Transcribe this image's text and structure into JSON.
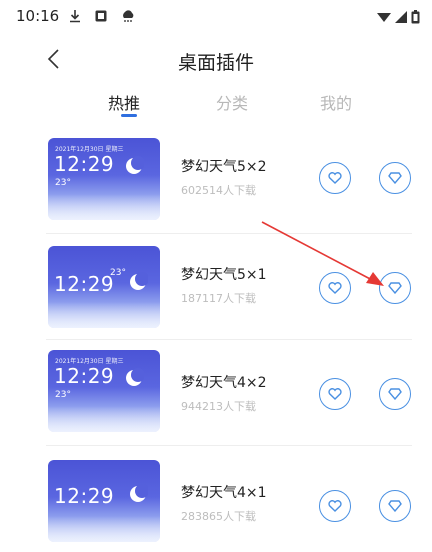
{
  "status_bar": {
    "time": "10:16",
    "icons": [
      "download-icon",
      "image-icon",
      "weather-icon",
      "wifi-icon",
      "signal-icon",
      "battery-icon"
    ]
  },
  "header": {
    "title": "桌面插件",
    "back_icon": "chevron-left-icon"
  },
  "tabs": [
    {
      "label": "热推",
      "active": true
    },
    {
      "label": "分类",
      "active": false
    },
    {
      "label": "我的",
      "active": false
    }
  ],
  "accent_color": "#2f6fe0",
  "button_color": "#4a90e2",
  "annotation_arrow_color": "#e53935",
  "widgets": [
    {
      "name": "梦幻天气5×2",
      "downloads": "602514人下载",
      "preview": {
        "time": "12:29",
        "temp": "23°"
      },
      "buttons": [
        "heart-icon",
        "diamond-icon"
      ]
    },
    {
      "name": "梦幻天气5×1",
      "downloads": "187117人下载",
      "preview": {
        "time": "12:29",
        "temp": "23°"
      },
      "buttons": [
        "heart-icon",
        "diamond-icon"
      ]
    },
    {
      "name": "梦幻天气4×2",
      "downloads": "944213人下载",
      "preview": {
        "time": "12:29",
        "temp": "23°"
      },
      "buttons": [
        "heart-icon",
        "diamond-icon"
      ]
    },
    {
      "name": "梦幻天气4×1",
      "downloads": "283865人下载",
      "preview": {
        "time": "12:29",
        "temp": ""
      },
      "buttons": [
        "heart-icon",
        "diamond-icon"
      ]
    }
  ]
}
